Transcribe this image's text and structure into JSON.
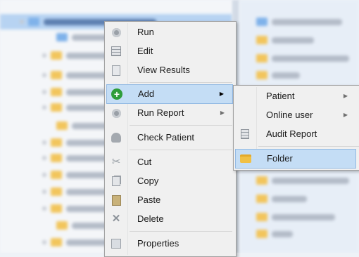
{
  "context_menu": {
    "items": [
      {
        "label": "Run",
        "icon": "gear-icon"
      },
      {
        "label": "Edit",
        "icon": "grid-icon"
      },
      {
        "label": "View Results",
        "icon": "document-icon"
      },
      {
        "label": "Add",
        "icon": "add-icon",
        "submenu": true,
        "active": true
      },
      {
        "label": "Run Report",
        "icon": "gear-icon",
        "submenu": true
      },
      {
        "label": "Check Patient",
        "icon": "person-icon"
      },
      {
        "label": "Cut",
        "icon": "scissors-icon"
      },
      {
        "label": "Copy",
        "icon": "copy-icon"
      },
      {
        "label": "Paste",
        "icon": "paste-icon"
      },
      {
        "label": "Delete",
        "icon": "delete-icon"
      },
      {
        "label": "Properties",
        "icon": "properties-icon"
      }
    ],
    "submenu_arrow": "▶"
  },
  "add_submenu": {
    "items": [
      {
        "label": "Patient",
        "submenu": true
      },
      {
        "label": "Online user",
        "submenu": true
      },
      {
        "label": "Audit Report",
        "icon": "report-icon"
      },
      {
        "label": "Folder",
        "icon": "folder-icon",
        "active": true
      }
    ]
  },
  "colors": {
    "highlight": "#c4ddf5",
    "highlight_border": "#92b9e3",
    "menu_bg": "#f0f0f0",
    "add_icon": "#2e9d3a",
    "folder_icon": "#f0c044"
  }
}
